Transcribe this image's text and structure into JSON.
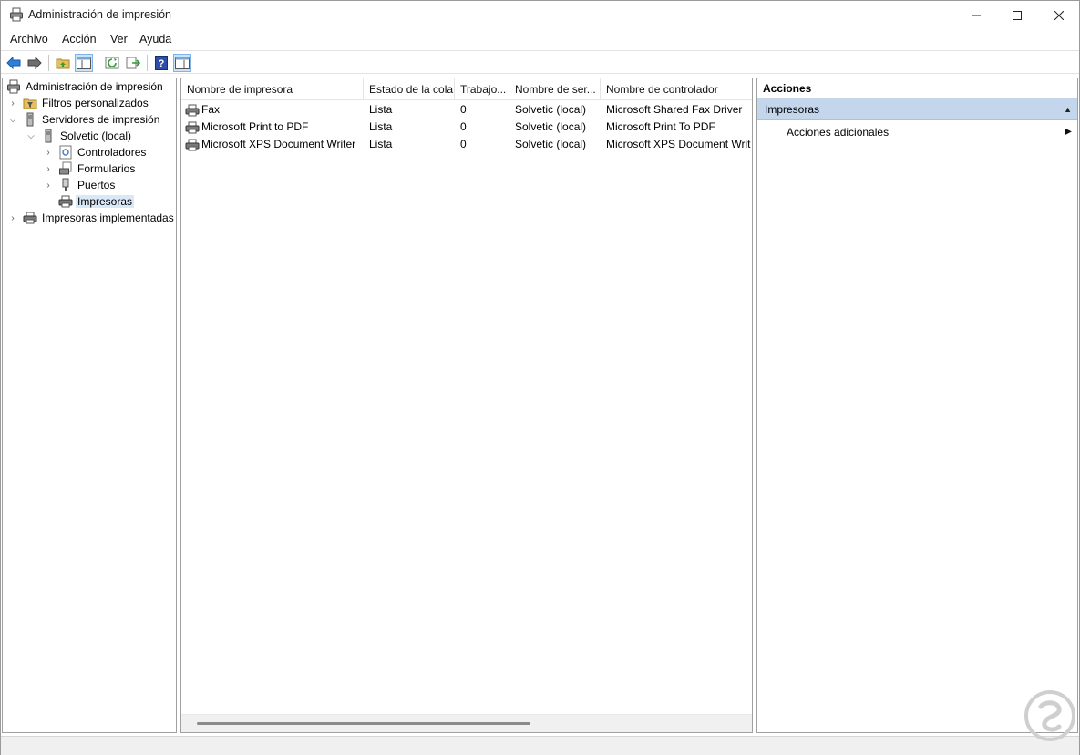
{
  "window": {
    "title": "Administración de impresión"
  },
  "menu": [
    "Archivo",
    "Acción",
    "Ver",
    "Ayuda"
  ],
  "toolbar": {
    "icons": [
      "back-icon",
      "forward-icon",
      "up-folder-icon",
      "show-hide-tree-icon",
      "refresh-icon",
      "export-list-icon",
      "help-icon",
      "show-hide-action-pane-icon"
    ]
  },
  "tree": {
    "root": "Administración de impresión",
    "items": [
      {
        "label": "Filtros personalizados"
      },
      {
        "label": "Servidores de impresión"
      },
      {
        "label": "Solvetic (local)"
      },
      {
        "label": "Controladores"
      },
      {
        "label": "Formularios"
      },
      {
        "label": "Puertos"
      },
      {
        "label": "Impresoras"
      },
      {
        "label": "Impresoras implementadas"
      }
    ]
  },
  "list": {
    "columns": [
      "Nombre de impresora",
      "Estado de la cola",
      "Trabajo...",
      "Nombre de ser...",
      "Nombre de controlador"
    ],
    "rows": [
      {
        "name": "Fax",
        "status": "Lista",
        "jobs": "0",
        "server": "Solvetic (local)",
        "driver": "Microsoft Shared Fax Driver"
      },
      {
        "name": "Microsoft Print to PDF",
        "status": "Lista",
        "jobs": "0",
        "server": "Solvetic (local)",
        "driver": "Microsoft Print To PDF"
      },
      {
        "name": "Microsoft XPS Document Writer",
        "status": "Lista",
        "jobs": "0",
        "server": "Solvetic (local)",
        "driver": "Microsoft XPS Document Writ"
      }
    ]
  },
  "actions": {
    "title": "Acciones",
    "section": "Impresoras",
    "item": "Acciones adicionales"
  },
  "colors": {
    "section_bg": "#c3d6ec",
    "selected_bg": "#d9e8f6"
  }
}
